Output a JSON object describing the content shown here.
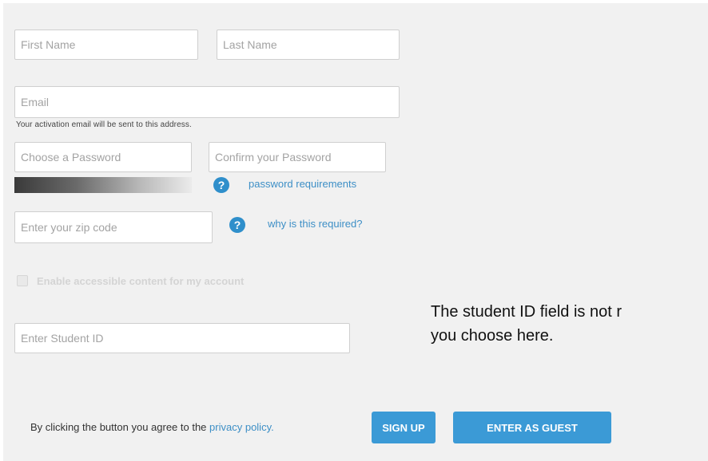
{
  "form": {
    "first_name": {
      "placeholder": "First Name",
      "value": ""
    },
    "last_name": {
      "placeholder": "Last Name",
      "value": ""
    },
    "email": {
      "placeholder": "Email",
      "value": "",
      "note": "Your activation email will be sent to this address."
    },
    "password": {
      "placeholder": "Choose a Password",
      "value": ""
    },
    "confirm_password": {
      "placeholder": "Confirm your Password",
      "value": ""
    },
    "password_help": {
      "icon": "help-icon",
      "glyph": "?",
      "link": "password requirements"
    },
    "zip": {
      "placeholder": "Enter your zip code",
      "value": ""
    },
    "zip_help": {
      "icon": "help-icon",
      "glyph": "?",
      "link": "why is this required?"
    },
    "accessible": {
      "label": "Enable accessible content for my account",
      "checked": false,
      "disabled": true
    },
    "student_id": {
      "placeholder": "Enter Student ID",
      "value": ""
    }
  },
  "annotation": {
    "text": "The student ID field is not r\nyou choose here."
  },
  "footer": {
    "agree_text": "By clicking the button you agree to the",
    "privacy_link": "privacy policy.",
    "sign_up_label": "SIGN UP",
    "guest_label": "ENTER AS GUEST"
  },
  "colors": {
    "accent": "#3b9ad6",
    "link": "#3d8fc6",
    "panel_bg": "#f1f1f1"
  }
}
